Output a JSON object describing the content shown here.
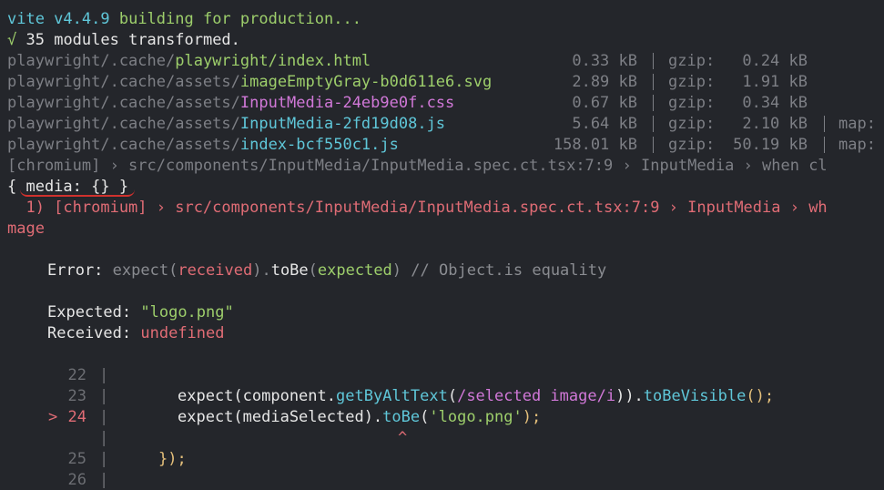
{
  "header": {
    "vite_version": "vite v4.4.9",
    "building": "building for production...",
    "check": "√",
    "modules": "35 modules transformed."
  },
  "files": [
    {
      "dir": "playwright/.cache/",
      "name": "playwright/index.html",
      "name_color": "green",
      "size": "0.33 kB",
      "gzip_label": "gzip:",
      "gzip": "0.24 kB",
      "map": ""
    },
    {
      "dir": "playwright/.cache/assets/",
      "name": "imageEmptyGray-b0d611e6.svg",
      "name_color": "green",
      "size": "2.89 kB",
      "gzip_label": "gzip:",
      "gzip": "1.91 kB",
      "map": ""
    },
    {
      "dir": "playwright/.cache/assets/",
      "name": "InputMedia-24eb9e0f.css",
      "name_color": "magenta",
      "size": "0.67 kB",
      "gzip_label": "gzip:",
      "gzip": "0.34 kB",
      "map": ""
    },
    {
      "dir": "playwright/.cache/assets/",
      "name": "InputMedia-2fd19d08.js",
      "name_color": "cyan",
      "size": "5.64 kB",
      "gzip_label": "gzip:",
      "gzip": "2.10 kB",
      "map": "map:"
    },
    {
      "dir": "playwright/.cache/assets/",
      "name": "index-bcf550c1.js",
      "name_color": "cyan",
      "size": "158.01 kB",
      "gzip_label": "gzip:",
      "gzip": "50.19 kB",
      "map": "map:"
    }
  ],
  "test_line": "[chromium] › src/components/InputMedia/InputMedia.spec.ct.tsx:7:9 › InputMedia › when cl",
  "media_line": "{ media: {} }",
  "failure_line": "  1) [chromium] › src/components/InputMedia/InputMedia.spec.ct.tsx:7:9 › InputMedia › wh",
  "failure_wrap": "mage",
  "error": {
    "label": "Error:",
    "expect": "expect(",
    "received": "received",
    "close1": ").",
    "tobe": "toBe",
    "open2": "(",
    "expected": "expected",
    "close2": ")",
    "comment": "// Object.is equality"
  },
  "expected_label": "Expected:",
  "expected_value": "\"logo.png\"",
  "received_label": "Received:",
  "received_value": "undefined",
  "code": {
    "lines": [
      {
        "marker": "",
        "num": "22"
      },
      {
        "marker": "",
        "num": "23"
      },
      {
        "marker": ">",
        "num": "24"
      },
      {
        "marker": "",
        "num": ""
      },
      {
        "marker": "",
        "num": "25"
      },
      {
        "marker": "",
        "num": "26"
      }
    ],
    "bar": "|",
    "line23": {
      "a": "expect(component.",
      "b": "getByAltText",
      "c": "(",
      "d": "/selected image/i",
      "e": ")).",
      "f": "toBeVisible",
      "g": "();"
    },
    "line24": {
      "a": "expect(mediaSelected).",
      "b": "toBe",
      "c": "(",
      "d": "'logo.png'",
      "e": ");"
    },
    "caret": "^",
    "line25": "});"
  }
}
